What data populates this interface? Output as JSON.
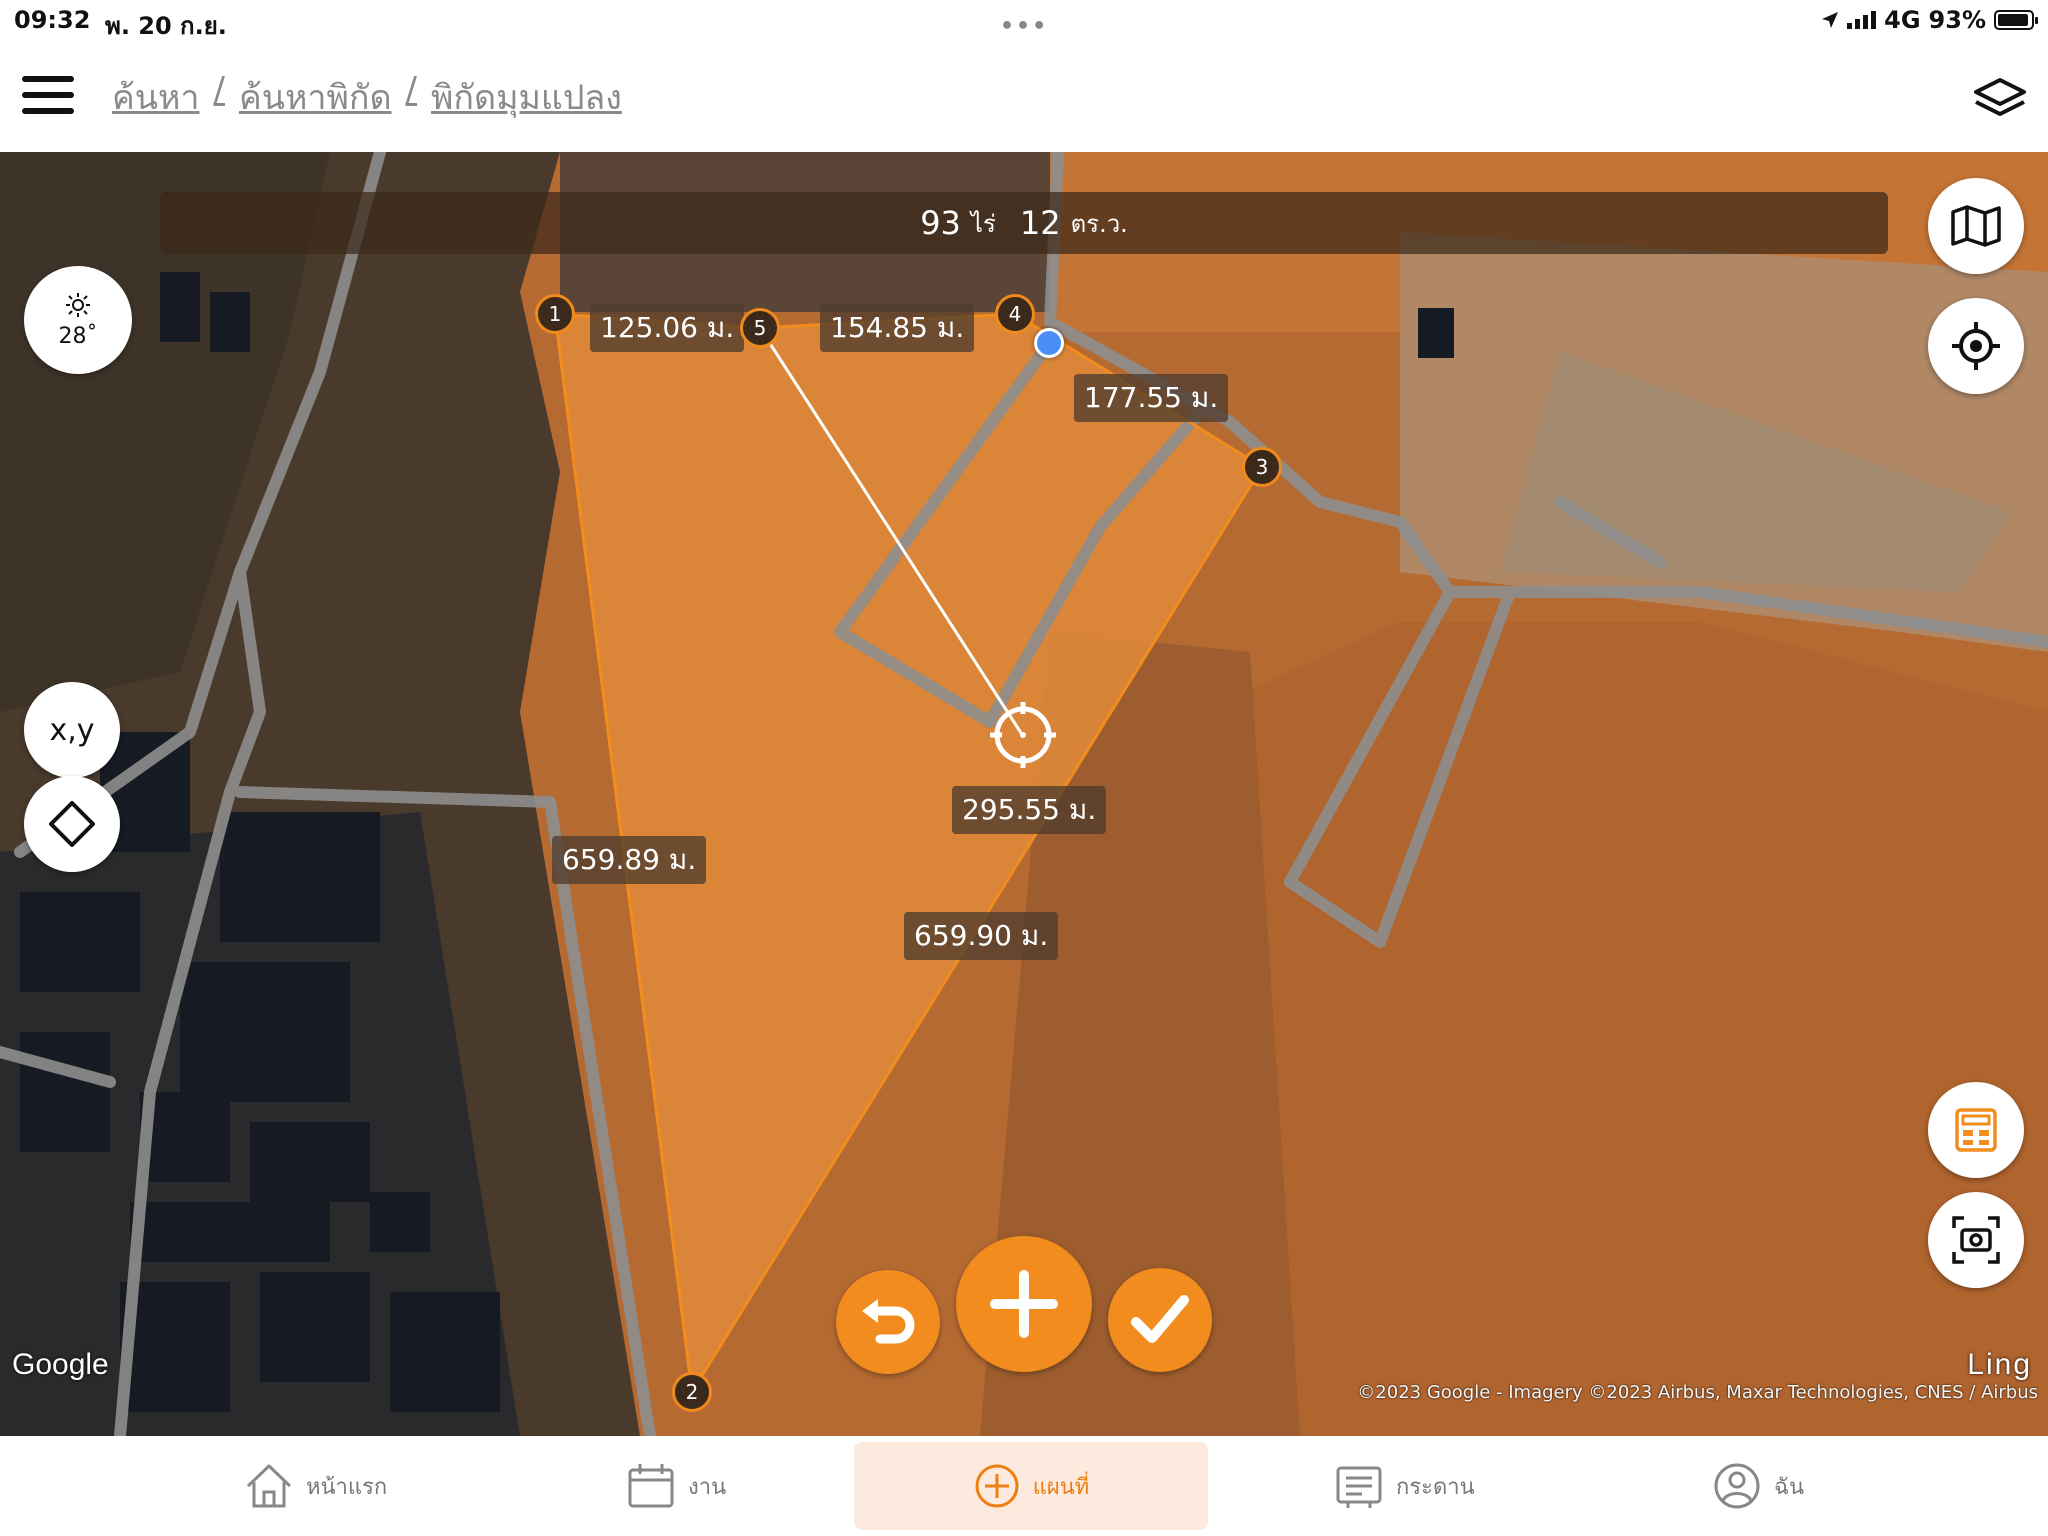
{
  "status_bar": {
    "time": "09:32",
    "date": "พ. 20 ก.ย.",
    "network": "4G",
    "battery": "93%",
    "battery_level": 0.93
  },
  "header": {
    "breadcrumb": [
      "ค้นหา",
      "/",
      "ค้นหาพิกัด",
      "/",
      "พิกัดมุมแปลง"
    ],
    "menu_icon": "hamburger-icon",
    "layers_icon": "layers-icon"
  },
  "map": {
    "area": {
      "rai_value": "93",
      "rai_unit": "ไร่",
      "sqwa_value": "12",
      "sqwa_unit": "ตร.ว."
    },
    "weather": {
      "icon": "sun-icon",
      "temperature": "28˚"
    },
    "coordinate_button": "x,y",
    "vertices": [
      "1",
      "2",
      "3",
      "4",
      "5"
    ],
    "distances": {
      "d1_5": "125.06 ม.",
      "d5_4": "154.85 ม.",
      "d4_3": "177.55 ม.",
      "d_cursor": "295.55 ม.",
      "d1_2": "659.89 ม.",
      "d2_3": "659.90 ม."
    },
    "google_logo": "Google",
    "watermark": "Ling",
    "copyright": "©2023 Google - Imagery ©2023 Airbus, Maxar Technologies, CNES / Airbus",
    "accent_color": "#f28c1f"
  },
  "tabs": [
    {
      "label": "หน้าแรก",
      "icon": "home-icon"
    },
    {
      "label": "งาน",
      "icon": "calendar-icon"
    },
    {
      "label": "แผนที่",
      "icon": "add-circle-icon",
      "active": true
    },
    {
      "label": "กระดาน",
      "icon": "board-icon"
    },
    {
      "label": "ฉัน",
      "icon": "user-icon"
    }
  ]
}
